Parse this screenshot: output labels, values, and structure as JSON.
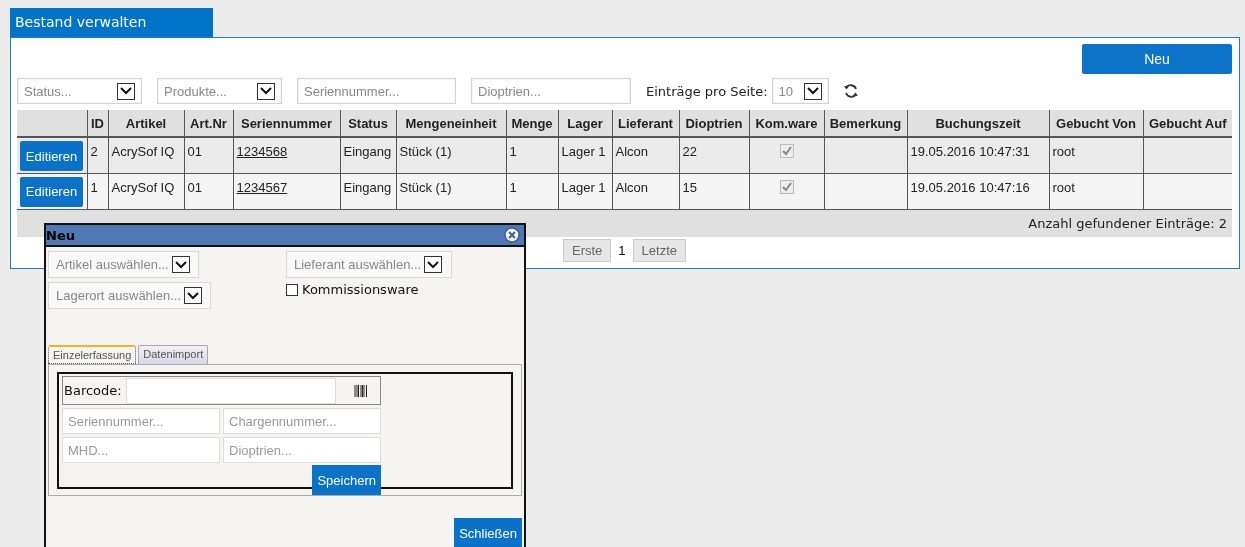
{
  "panel": {
    "title": "Bestand verwalten",
    "new_button": "Neu",
    "filters": [
      {
        "kind": "select",
        "placeholder": "Status..."
      },
      {
        "kind": "select",
        "placeholder": "Produkte..."
      },
      {
        "kind": "input",
        "placeholder": "Seriennummer..."
      },
      {
        "kind": "input",
        "placeholder": "Dioptrien..."
      }
    ],
    "page_size": {
      "label": "Einträge pro Seite:",
      "value": "10"
    },
    "table": {
      "columns": [
        "",
        "ID",
        "Artikel",
        "Art.Nr",
        "Seriennummer",
        "Status",
        "Mengeneinheit",
        "Menge",
        "Lager",
        "Lieferant",
        "Dioptrien",
        "Kom.ware",
        "Bemerkung",
        "Buchungszeit",
        "Gebucht Von",
        "Gebucht Auf"
      ],
      "rows": [
        {
          "edit": "Editieren",
          "id": "2",
          "artikel": "AcrySof IQ",
          "art_nr": "01",
          "seriennummer": "1234568",
          "status": "Eingang",
          "mengeneinheit": "Stück (1)",
          "menge": "1",
          "lager": "Lager 1",
          "lieferant": "Alcon",
          "dioptrien": "22",
          "kom_ware": true,
          "buchungszeit": "19.05.2016 10:47:31",
          "gebucht_von": "root"
        },
        {
          "edit": "Editieren",
          "id": "1",
          "artikel": "AcrySof IQ",
          "art_nr": "01",
          "seriennummer": "1234567",
          "status": "Eingang",
          "mengeneinheit": "Stück (1)",
          "menge": "1",
          "lager": "Lager 1",
          "lieferant": "Alcon",
          "dioptrien": "15",
          "kom_ware": true,
          "buchungszeit": "19.05.2016 10:47:16",
          "gebucht_von": "root"
        }
      ],
      "footer": "Anzahl gefundener Einträge: 2"
    },
    "pagination": {
      "first": "Erste",
      "current": "1",
      "last": "Letzte"
    }
  },
  "dialog": {
    "title": "Neu",
    "selects": [
      {
        "placeholder": "Artikel auswählen..."
      },
      {
        "placeholder": "Lieferant auswählen..."
      },
      {
        "placeholder": "Lagerort auswählen..."
      }
    ],
    "kommissionsware": {
      "label": "Kommissionsware",
      "checked": false
    },
    "tabs": [
      {
        "label": "Einzelerfassung",
        "selected": true
      },
      {
        "label": "Datenimport",
        "selected": false
      }
    ],
    "barcode_label": "Barcode:",
    "fields": [
      {
        "placeholder": "Seriennummer..."
      },
      {
        "placeholder": "Chargennummer..."
      },
      {
        "placeholder": "MHD..."
      },
      {
        "placeholder": "Dioptrien..."
      }
    ],
    "save_button": "Speichern",
    "close_button": "Schließen"
  }
}
